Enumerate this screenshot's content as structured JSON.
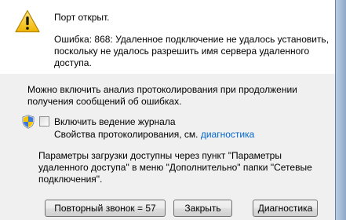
{
  "dialog": {
    "title": "Порт открыт.",
    "error_lines": [
      "Ошибка: 868: Удаленное подключение не удалось установить,",
      "поскольку не удалось разрешить имя сервера удаленного",
      "доступа."
    ],
    "info_lines": [
      "Можно включить анализ протоколирования при продолжении",
      "получения сообщений об ошибках."
    ],
    "logging": {
      "checkbox_label": "Включить ведение журнала",
      "checked": false,
      "description_prefix": "Свойства протоколирования, см. ",
      "link_text": "диагностика"
    },
    "params_lines": [
      "Параметры загрузки доступны через пункт \"Параметры",
      "удаленного доступа\" в меню \"Дополнительно\" папки \"Сетевые",
      "подключения\"."
    ],
    "buttons": {
      "redial": "Повторный звонок = 57",
      "close": "Закрыть",
      "diagnostics": "Диагностика"
    },
    "icons": [
      "warning-icon",
      "shield-icon"
    ],
    "colors": {
      "link": "#0066cc",
      "background": "#f0f0f0",
      "header_background": "#ffffff"
    }
  }
}
